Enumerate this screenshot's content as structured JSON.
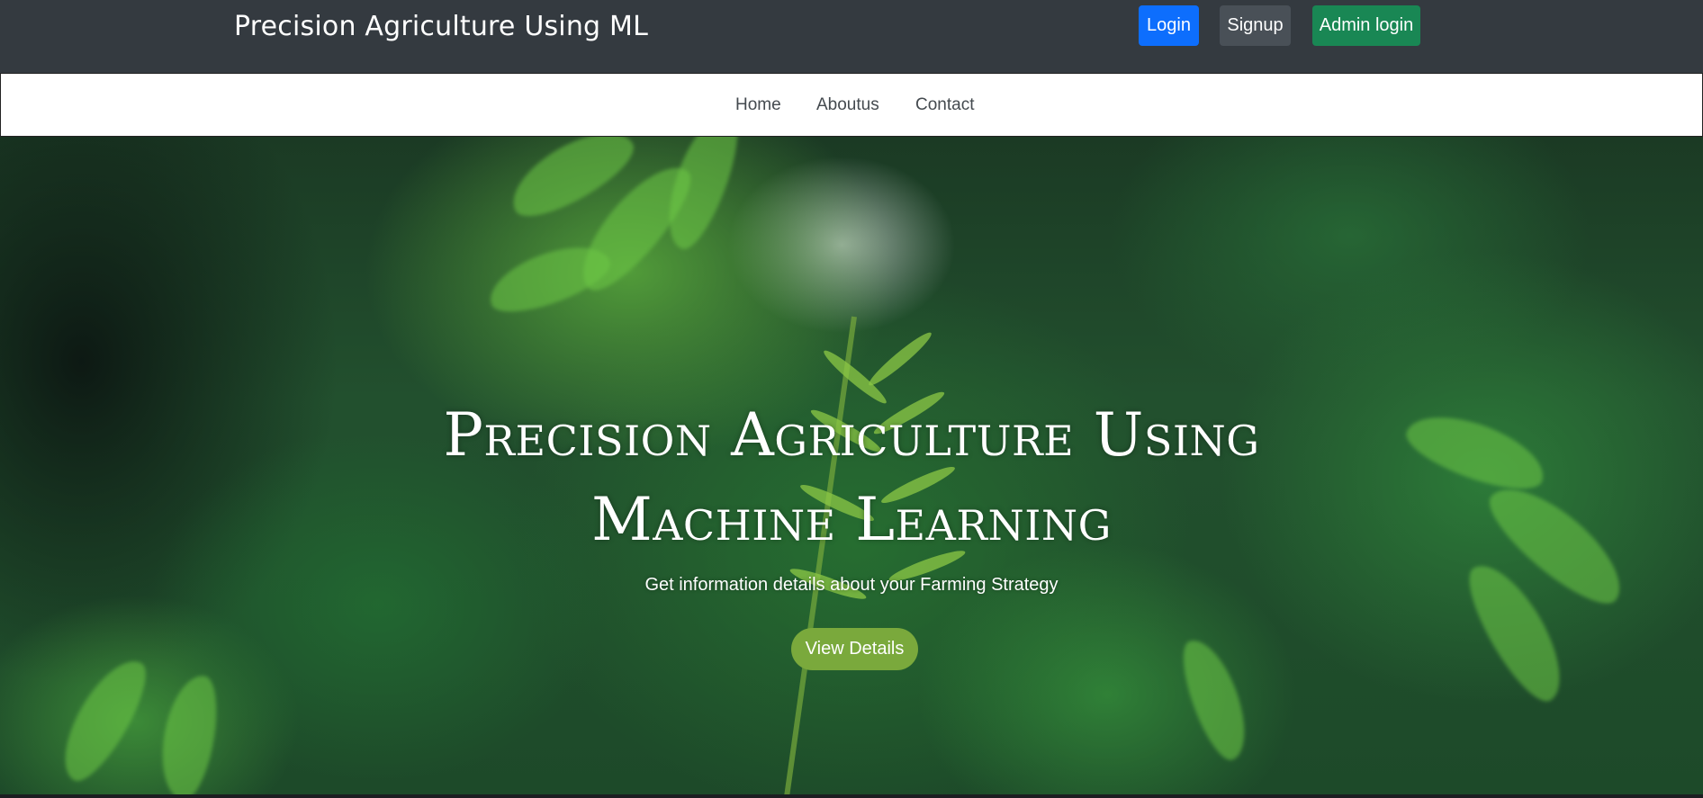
{
  "header": {
    "brand": "Precision Agriculture Using ML",
    "buttons": {
      "login": "Login",
      "signup": "Signup",
      "admin_login": "Admin login"
    }
  },
  "nav": {
    "items": [
      {
        "label": "Home"
      },
      {
        "label": "Aboutus"
      },
      {
        "label": "Contact"
      }
    ]
  },
  "hero": {
    "title": "Precision Agriculture Using Machine Learning",
    "subtitle": "Get information details about your Farming Strategy",
    "cta_label": "View Details"
  },
  "colors": {
    "topbar": "#343a40",
    "login_button": "#0d6efd",
    "signup_button": "#495057",
    "admin_button": "#198754",
    "cta_button": "#7aa93c"
  }
}
